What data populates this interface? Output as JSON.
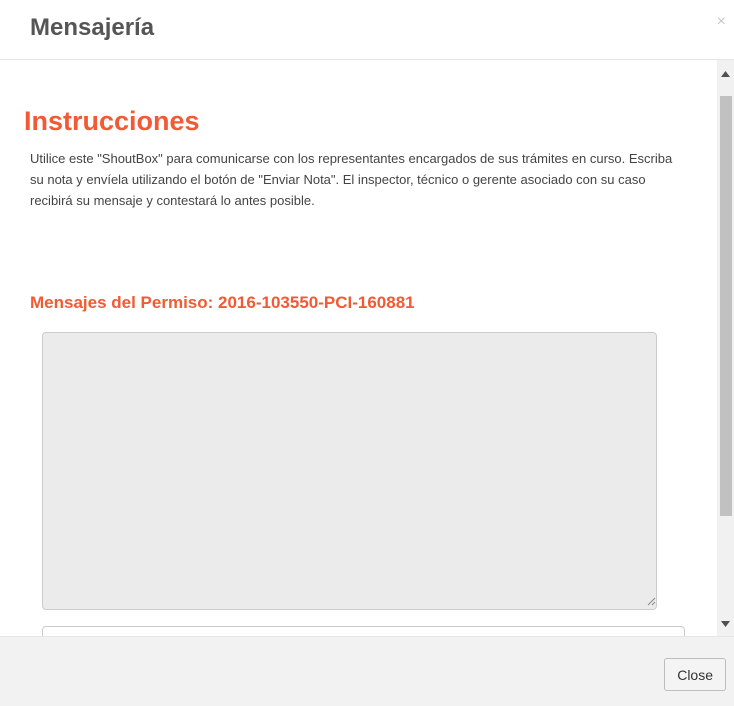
{
  "modal": {
    "title": "Mensajería",
    "close_glyph": "×"
  },
  "body": {
    "heading": "Instrucciones",
    "instructions": "Utilice este \"ShoutBox\" para comunicarse con los representantes encargados de sus trámites en curso. Escriba su nota y envíela utilizando el botón de \"Enviar Nota\". El inspector, técnico o gerente asociado con su caso recibirá su mensaje y contestará lo antes posible.",
    "permit_heading": "Mensajes del Permiso: 2016-103550-PCI-160881",
    "messages_value": "",
    "note_value": ""
  },
  "footer": {
    "close_label": "Close"
  },
  "colors": {
    "accent": "#f15a34",
    "title": "#555555",
    "textarea_bg": "#ebebeb",
    "footer_bg": "#f2f2f2"
  },
  "icons": {
    "dismiss": "close-icon",
    "scroll_up": "scroll-up-arrow-icon",
    "scroll_down": "scroll-down-arrow-icon",
    "resize": "resize-grip-icon"
  }
}
